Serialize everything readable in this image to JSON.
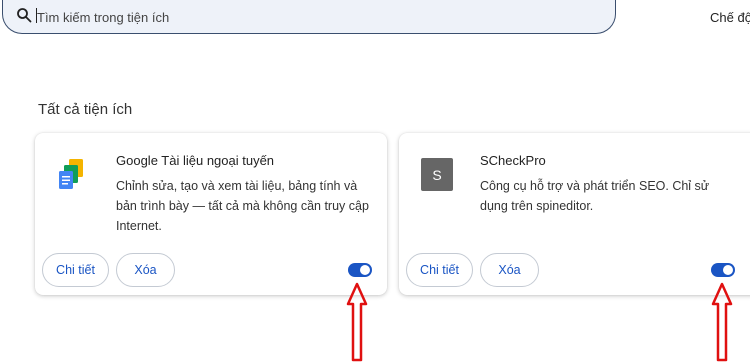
{
  "search": {
    "placeholder": "Tìm kiếm trong tiện ích"
  },
  "header": {
    "mode_label": "Chế độ"
  },
  "section": {
    "title": "Tất cả tiện ích"
  },
  "extensions": [
    {
      "name": "Google Tài liệu ngoại tuyến",
      "description": "Chỉnh sửa, tạo và xem tài liệu, bảng tính và bản trình bày — tất cả mà không cần truy cập Internet.",
      "details_label": "Chi tiết",
      "remove_label": "Xóa",
      "enabled": true,
      "icon": "google-docs-icon"
    },
    {
      "name": "SCheckPro",
      "description": "Công cụ hỗ trợ và phát triển SEO. Chỉ sử dụng trên spineditor.",
      "details_label": "Chi tiết",
      "remove_label": "Xóa",
      "enabled": true,
      "icon_letter": "S"
    }
  ],
  "colors": {
    "accent": "#1a55c4",
    "arrow": "#e01010",
    "search_bg": "#eef2f9"
  }
}
